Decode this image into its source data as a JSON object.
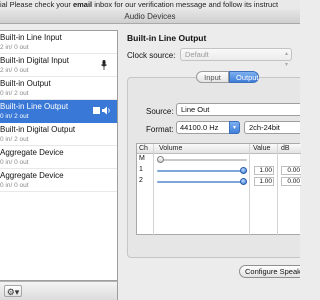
{
  "banner": {
    "prefix": "ial Please check your ",
    "bold": "email",
    "suffix": " inbox for our verification message and follow its instruct"
  },
  "window": {
    "title": "Audio Devices"
  },
  "devices": [
    {
      "name": "Built-in Line Input",
      "io": "2 in/ 0 out",
      "icon": ""
    },
    {
      "name": "Built-in Digital Input",
      "io": "2 in/ 0 out",
      "icon": "microphone-icon"
    },
    {
      "name": "Built-in Output",
      "io": "0 in/ 2 out",
      "icon": ""
    },
    {
      "name": "Built-in Line Output",
      "io": "0 in/ 2 out",
      "icon": "speaker-output-icon",
      "selected": true
    },
    {
      "name": "Built-in Digital Output",
      "io": "0 in/ 2 out",
      "icon": ""
    },
    {
      "name": "Aggregate Device",
      "io": "0 in/ 0 out",
      "icon": ""
    },
    {
      "name": "Aggregate Device",
      "io": "0 in/ 0 out",
      "icon": ""
    }
  ],
  "list_footer": {
    "plus": "+",
    "gear": "⚙▾"
  },
  "detail": {
    "title": "Built-in Line Output",
    "clock_label": "Clock source:",
    "clock_value": "Default",
    "tabs": [
      {
        "label": "Input",
        "active": false
      },
      {
        "label": "Output",
        "active": true
      }
    ],
    "source_label": "Source:",
    "source_value": "Line Out",
    "format_label": "Format:",
    "format_value": "44100.0 Hz",
    "format_bits": "2ch-24bit",
    "table": {
      "headers": [
        "Ch",
        "Volume",
        "Value",
        "dB"
      ],
      "rows": [
        {
          "ch": "M",
          "value": "",
          "db": "",
          "level": 0.0
        },
        {
          "ch": "1",
          "value": "1.00",
          "db": "0.00",
          "level": 1.0
        },
        {
          "ch": "2",
          "value": "1.00",
          "db": "0.00",
          "level": 1.0
        }
      ]
    },
    "configure_button": "Configure Speakers..."
  },
  "colors": {
    "selection": "#3a78d7",
    "accent": "#3f7ed8"
  }
}
